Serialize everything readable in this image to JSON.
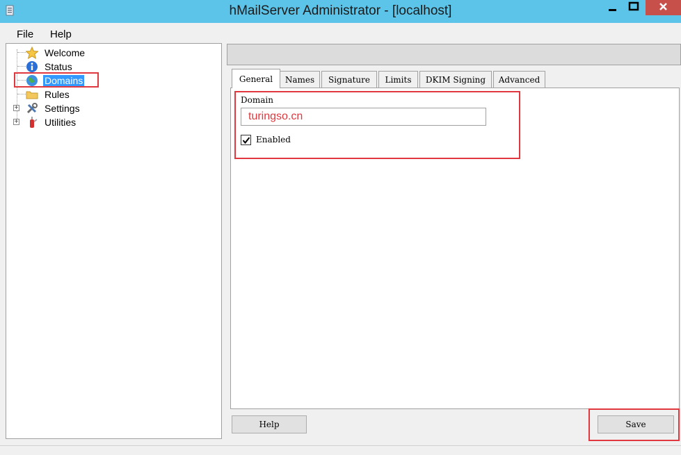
{
  "window": {
    "title": "hMailServer Administrator - [localhost]"
  },
  "menu": {
    "items": [
      "File",
      "Help"
    ]
  },
  "tree": {
    "items": [
      {
        "label": "Welcome",
        "icon": "star-icon"
      },
      {
        "label": "Status",
        "icon": "info-icon"
      },
      {
        "label": "Domains",
        "icon": "globe-icon",
        "selected": true
      },
      {
        "label": "Rules",
        "icon": "folder-icon"
      },
      {
        "label": "Settings",
        "icon": "tools-icon",
        "expandable": true
      },
      {
        "label": "Utilities",
        "icon": "swiss-knife-icon",
        "expandable": true
      }
    ]
  },
  "tabs": [
    "General",
    "Names",
    "Signature",
    "Limits",
    "DKIM Signing",
    "Advanced"
  ],
  "general": {
    "domain_label": "Domain",
    "domain_value": "turingso.cn",
    "enabled_label": "Enabled",
    "enabled": true
  },
  "buttons": {
    "help": "Help",
    "save": "Save"
  },
  "colors": {
    "titlebar": "#5bc4e8",
    "selection": "#3399ff",
    "annotation": "#e0383e",
    "close": "#c7504b"
  }
}
